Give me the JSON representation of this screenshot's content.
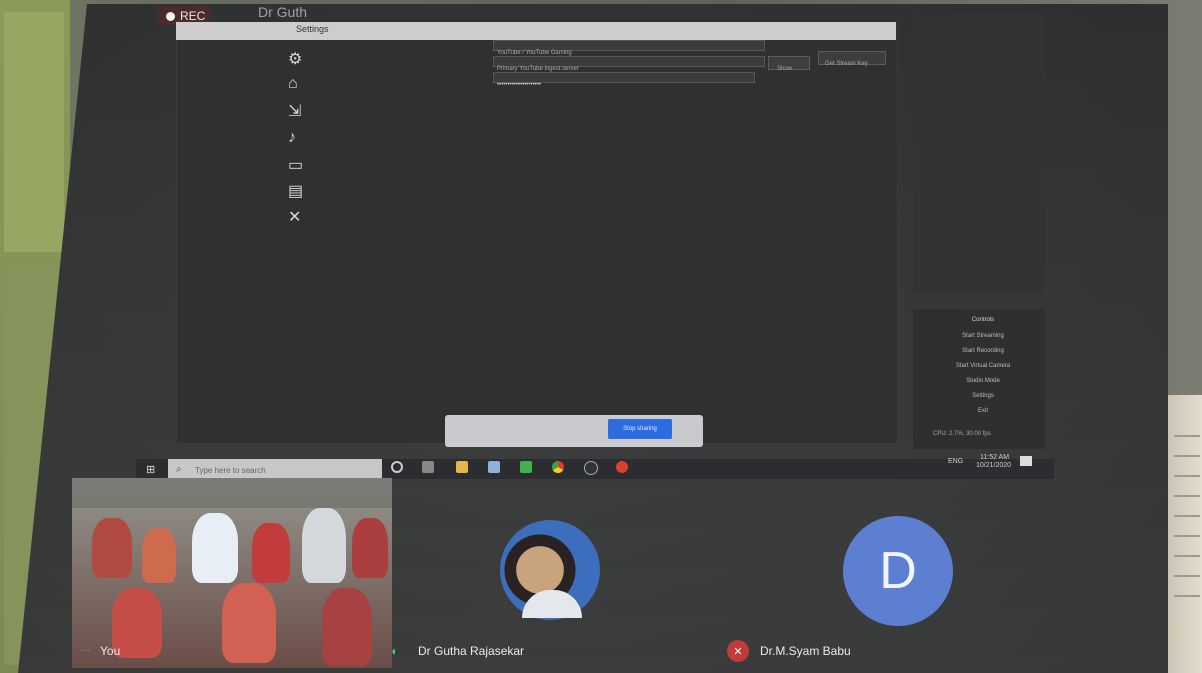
{
  "recording": {
    "label": "REC"
  },
  "header_name": {
    "label": "Dr Guth"
  },
  "obs": {
    "settings_tab": "Settings",
    "service_value": "YouTube / YouTube Gaming",
    "server_value": "Primary YouTube ingest server",
    "stream_key_mask": "•••••••••••••••••••••",
    "show_button": "Show",
    "get_key_button": "Get Stream Key",
    "controls_title": "Controls",
    "controls": [
      "Start Streaming",
      "Start Recording",
      "Start Virtual Camera",
      "Studio Mode",
      "Settings",
      "Exit"
    ],
    "status": "CPU: 2.7%, 30.00 fps"
  },
  "share": {
    "stop_label": "Stop sharing"
  },
  "taskbar": {
    "search_placeholder": "Type here to search",
    "tray_lang": "ENG",
    "tray_time": "11:52 AM",
    "tray_date": "10/21/2020"
  },
  "participants": {
    "you": "You",
    "p1": "Dr Gutha Rajasekar",
    "p2": "Dr.M.Syam Babu",
    "p2_initial": "D"
  },
  "colors": {
    "accent": "#2d6cdf",
    "avatar": "#5c7fd2",
    "muted": "#c23b3b",
    "speaking": "#54c66a"
  }
}
